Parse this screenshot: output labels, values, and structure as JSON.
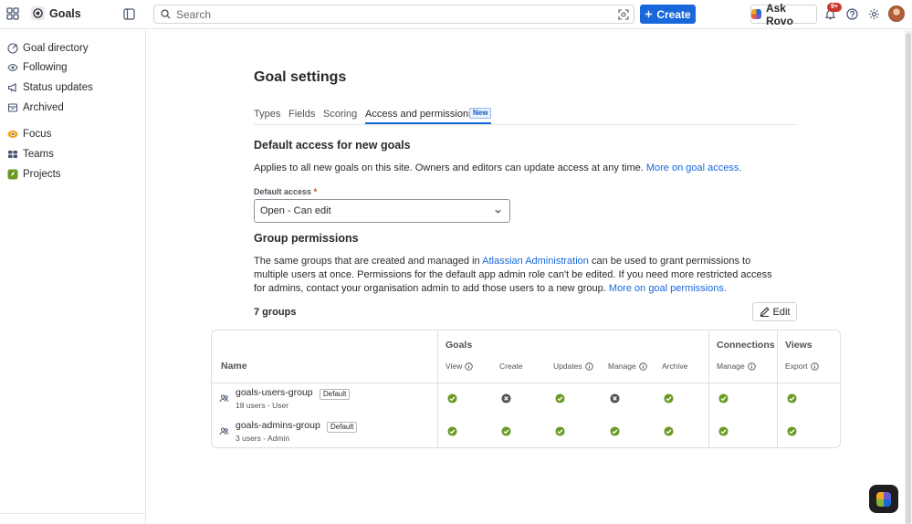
{
  "app": {
    "name": "Goals"
  },
  "search": {
    "placeholder": "Search"
  },
  "topbar": {
    "create_label": "Create",
    "ask_rovo_label": "Ask Rovo",
    "notifications_badge": "9+"
  },
  "sidebar": {
    "items": [
      {
        "label": "Goal directory",
        "icon": "target-icon"
      },
      {
        "label": "Following",
        "icon": "eye-icon"
      },
      {
        "label": "Status updates",
        "icon": "megaphone-icon"
      },
      {
        "label": "Archived",
        "icon": "archive-icon"
      },
      {
        "label": "Focus",
        "icon": "focus-icon"
      },
      {
        "label": "Teams",
        "icon": "teams-icon"
      },
      {
        "label": "Projects",
        "icon": "rocket-icon"
      }
    ]
  },
  "page": {
    "title": "Goal settings",
    "tabs": [
      {
        "label": "Types"
      },
      {
        "label": "Fields"
      },
      {
        "label": "Scoring"
      },
      {
        "label": "Access and permissions",
        "badge": "New",
        "active": true
      }
    ]
  },
  "default_access": {
    "heading": "Default access for new goals",
    "description": "Applies to all new goals on this site. Owners and editors can update access at any time.",
    "link": "More on goal access.",
    "field_label": "Default access",
    "required_marker": "*",
    "selected_value": "Open - Can edit"
  },
  "group_permissions": {
    "heading": "Group permissions",
    "text_1": "The same groups that are created and managed in",
    "admin_link": "Atlassian Administration",
    "text_2": "can be used to grant permissions to multiple users at once. Permissions for the default app admin role can't be edited. If you need more restricted access for admins, contact your organisation admin to add those users to a new group.",
    "permissions_link": "More on goal permissions.",
    "groups_count": "7 groups",
    "edit_label": "Edit"
  },
  "table": {
    "headers": {
      "name": "Name",
      "goals": "Goals",
      "connections": "Connections",
      "views": "Views"
    },
    "subheaders": [
      "View",
      "Create",
      "Updates",
      "Manage",
      "Archive",
      "Manage",
      "Export"
    ],
    "rows": [
      {
        "name": "goals-users-group",
        "badge": "Default",
        "sub": "18 users - User",
        "cells": [
          "allowed",
          "denied",
          "allowed",
          "denied",
          "allowed",
          "allowed",
          "allowed"
        ]
      },
      {
        "name": "goals-admins-group",
        "badge": "Default",
        "sub": "3 users - Admin",
        "cells": [
          "allowed",
          "allowed",
          "allowed",
          "allowed",
          "allowed",
          "allowed",
          "allowed"
        ]
      }
    ]
  },
  "colors": {
    "accent": "#1868db",
    "allowed": "#6a9a23",
    "denied": "#505258"
  }
}
